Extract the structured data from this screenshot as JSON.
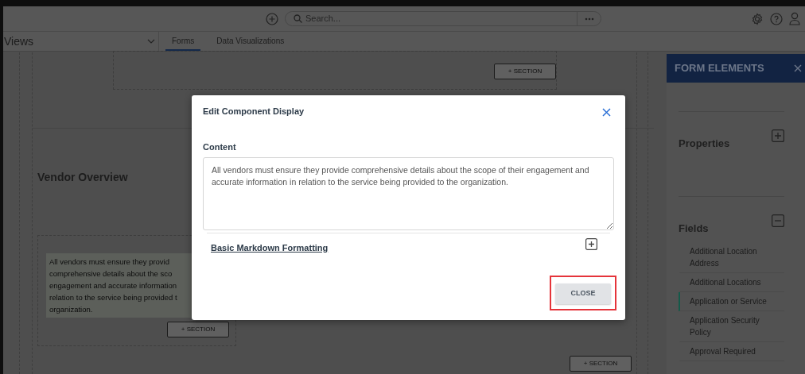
{
  "top_bar": {
    "search": {
      "placeholder": "Search..."
    }
  },
  "view_selector": {
    "label": "Views"
  },
  "tabs": [
    {
      "label": "Forms",
      "selected": true
    },
    {
      "label": "Data Visualizations",
      "selected": false
    }
  ],
  "canvas": {
    "section_buttons": [
      "+ SECTION",
      "+ SECTION",
      "+ SECTION"
    ],
    "section_title": "Vendor Overview",
    "text_lines": [
      "All vendors must ensure they provid",
      "comprehensive details about the sco",
      "engagement and accurate information",
      "relation to the service being provided t",
      "organization."
    ]
  },
  "form_elements": {
    "title": "FORM ELEMENTS",
    "groups": [
      {
        "title": "Properties",
        "expanded": false
      },
      {
        "title": "Fields",
        "expanded": true,
        "items": [
          {
            "label": "Additional Location Address",
            "selected": false
          },
          {
            "label": "Additional Locations",
            "selected": false
          },
          {
            "label": "Application or Service",
            "selected": true
          },
          {
            "label": "Application Security Policy",
            "selected": false
          },
          {
            "label": "Approval Required",
            "selected": false
          }
        ]
      }
    ]
  },
  "modal": {
    "title": "Edit Component Display",
    "content_label": "Content",
    "content_value": "All vendors must ensure they provide comprehensive details about the scope of their engagement and accurate information in relation to the service being provided to the organization.",
    "markdown_link": "Basic Markdown Formatting",
    "markdown_expanded": false,
    "close_button": {
      "label": "CLOSE",
      "highlighted": true
    }
  }
}
